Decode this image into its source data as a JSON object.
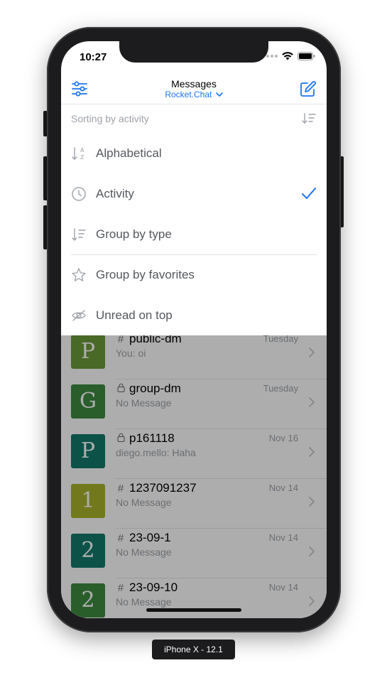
{
  "status": {
    "time": "10:27"
  },
  "header": {
    "title": "Messages",
    "server": "Rocket.Chat"
  },
  "sort_bar": {
    "label": "Sorting by activity"
  },
  "sort_menu": {
    "items": [
      {
        "label": "Alphabetical",
        "icon": "sort-alpha-icon",
        "selected": false
      },
      {
        "label": "Activity",
        "icon": "clock-icon",
        "selected": true
      },
      {
        "label": "Group by type",
        "icon": "sort-group-icon",
        "selected": false
      },
      {
        "label": "Group by favorites",
        "icon": "star-icon",
        "selected": false
      },
      {
        "label": "Unread on top",
        "icon": "eye-off-icon",
        "selected": false
      }
    ]
  },
  "rooms": [
    {
      "avatar": "P",
      "color": "#6c9b3a",
      "type": "#",
      "name": "public-dm",
      "message": "You: oi",
      "date": "Tuesday"
    },
    {
      "avatar": "G",
      "color": "#3d8b40",
      "type": "lock",
      "name": "group-dm",
      "message": "No Message",
      "date": "Tuesday"
    },
    {
      "avatar": "P",
      "color": "#127a6a",
      "type": "lock",
      "name": "p161118",
      "message": "diego.mello: Haha",
      "date": "Nov 16"
    },
    {
      "avatar": "1",
      "color": "#a8b32a",
      "type": "#",
      "name": "1237091237",
      "message": "No Message",
      "date": "Nov 14"
    },
    {
      "avatar": "2",
      "color": "#127a6a",
      "type": "#",
      "name": "23-09-1",
      "message": "No Message",
      "date": "Nov 14"
    },
    {
      "avatar": "2",
      "color": "#3d8b40",
      "type": "#",
      "name": "23-09-10",
      "message": "No Message",
      "date": "Nov 14"
    }
  ],
  "colors": {
    "accent": "#1d74f5",
    "overlay": "rgba(0,0,0,0.32)"
  },
  "device_label": "iPhone X - 12.1"
}
